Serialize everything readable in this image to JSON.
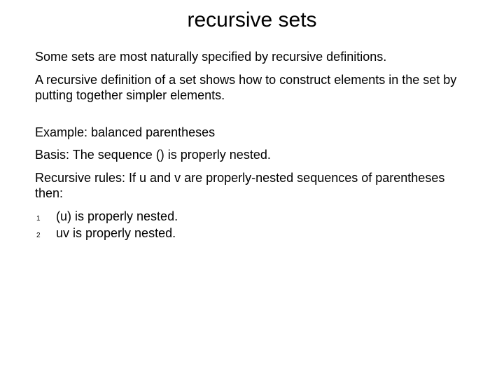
{
  "title": "recursive sets",
  "para1": "Some sets are most naturally specified by recursive definitions.",
  "para2": "A recursive definition of a set shows how to construct elements in the set by putting together simpler elements.",
  "example_label": "Example:",
  "example_text": "  balanced parentheses",
  "basis": "Basis: The sequence () is properly nested.",
  "rules_intro": "Recursive rules: If u and v are properly-nested sequences of parentheses then:",
  "rules": [
    {
      "n": "1",
      "text": "(u) is properly nested."
    },
    {
      "n": "2",
      "text": "uv is properly nested."
    }
  ]
}
